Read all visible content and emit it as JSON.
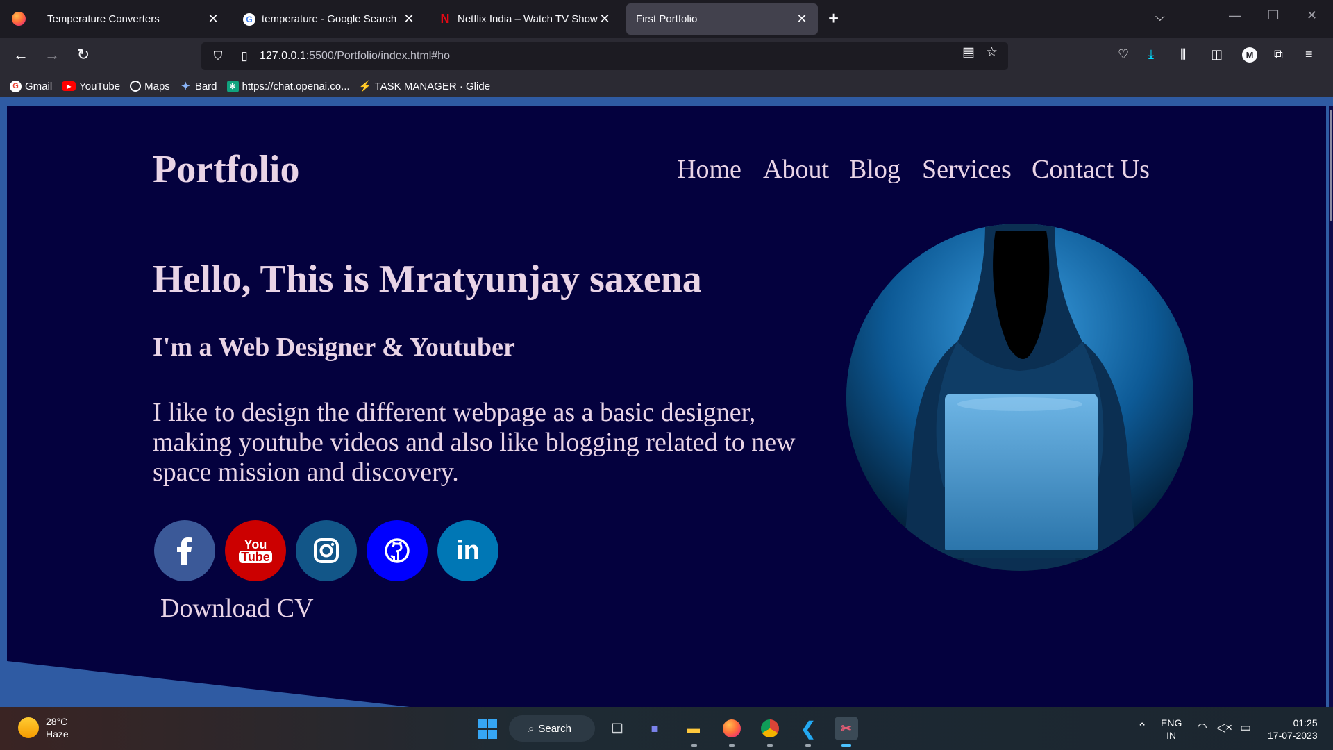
{
  "browser": {
    "tabs": [
      {
        "title": "Temperature Converters",
        "favicon": "firefox-page-icon",
        "active": false
      },
      {
        "title": "temperature - Google Search",
        "favicon": "google-icon",
        "active": false
      },
      {
        "title": "Netflix India – Watch TV Shows Online",
        "favicon": "netflix-icon",
        "active": false
      },
      {
        "title": "First Portfolio",
        "favicon": "none",
        "active": true
      }
    ],
    "url_host": "127.0.0.1",
    "url_path": ":5500/Portfolio/index.html#ho",
    "bookmarks": [
      {
        "label": "Gmail",
        "icon": "google-icon"
      },
      {
        "label": "YouTube",
        "icon": "youtube-icon"
      },
      {
        "label": "Maps",
        "icon": "globe-icon"
      },
      {
        "label": "Bard",
        "icon": "bard-icon"
      },
      {
        "label": "https://chat.openai.co...",
        "icon": "openai-icon"
      },
      {
        "label": "TASK MANAGER · Glide",
        "icon": "glide-icon"
      }
    ],
    "account_initial": "M"
  },
  "page": {
    "logo": "Portfolio",
    "nav": [
      "Home",
      "About",
      "Blog",
      "Services",
      "Contact Us"
    ],
    "headline": "Hello, This is Mratyunjay saxena",
    "subhead": "I'm a Web Designer & Youtuber",
    "intro": "I like to design the different webpage as a basic designer, making youtube videos and also like blogging related to new space mission and discovery.",
    "social": [
      {
        "name": "facebook",
        "color": "#3b5998"
      },
      {
        "name": "youtube",
        "color": "#cc0000"
      },
      {
        "name": "instagram",
        "color": "#125688"
      },
      {
        "name": "github",
        "color": "#0000ff"
      },
      {
        "name": "linkedin",
        "color": "#0077b5"
      }
    ],
    "youtube_logo_text": [
      "You",
      "Tube"
    ],
    "linkedin_logo_text": "in",
    "download_label": "Download CV",
    "colors": {
      "background": "#04013e",
      "accent_band": "#2f5ba3",
      "text": "#e9d4e6"
    }
  },
  "taskbar": {
    "weather_temp": "28°C",
    "weather_desc": "Haze",
    "search_label": "Search",
    "language": "ENG",
    "region": "IN",
    "time": "01:25",
    "date": "17-07-2023"
  }
}
